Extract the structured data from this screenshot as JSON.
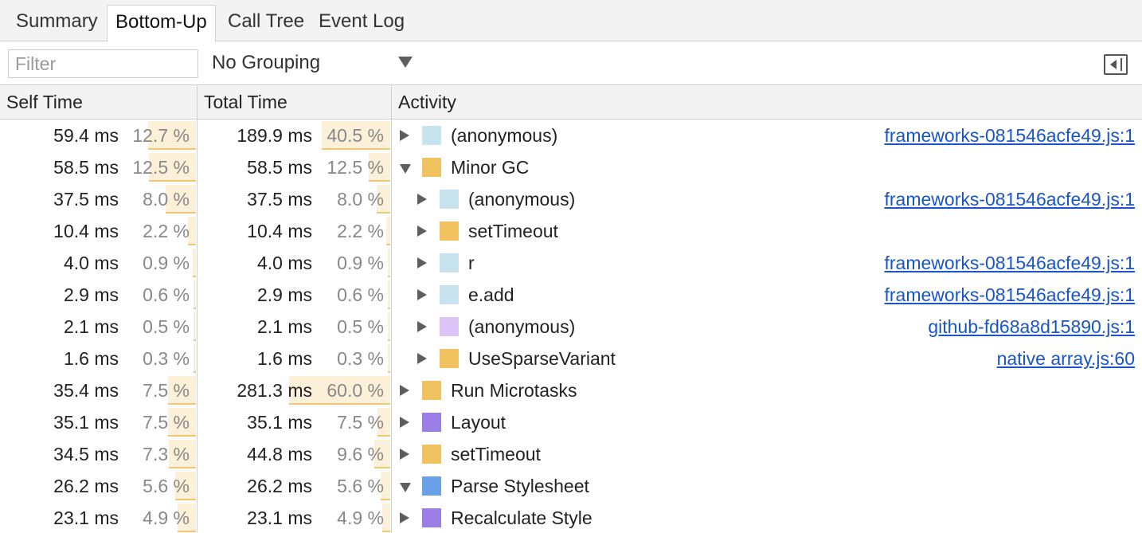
{
  "tabs": [
    {
      "label": "Summary",
      "active": false
    },
    {
      "label": "Bottom-Up",
      "active": true
    },
    {
      "label": "Call Tree",
      "active": false
    },
    {
      "label": "Event Log",
      "active": false
    }
  ],
  "toolbar": {
    "filter_placeholder": "Filter",
    "filter_value": "",
    "grouping_selected": "No Grouping"
  },
  "header": {
    "self_time": "Self Time",
    "total_time": "Total Time",
    "activity": "Activity"
  },
  "colors": {
    "scripting_light": "#c7e3ee",
    "scripting": "#f0c260",
    "rendering": "#9b7fe6",
    "rendering_light": "#dcc4f6",
    "loading": "#6aa0e6",
    "link": "#1a55c7"
  },
  "rows": [
    {
      "self_ms": "59.4 ms",
      "self_pct": "12.7 %",
      "self_frac": 0.127,
      "total_ms": "189.9 ms",
      "total_pct": "40.5 %",
      "total_frac": 0.405,
      "depth": 0,
      "expander": "collapsed",
      "color": "#c7e3ee",
      "name": "(anonymous)",
      "url": "frameworks-081546acfe49.js:1"
    },
    {
      "self_ms": "58.5 ms",
      "self_pct": "12.5 %",
      "self_frac": 0.125,
      "total_ms": "58.5 ms",
      "total_pct": "12.5 %",
      "total_frac": 0.125,
      "depth": 0,
      "expander": "expanded",
      "color": "#f0c260",
      "name": "Minor GC",
      "url": ""
    },
    {
      "self_ms": "37.5 ms",
      "self_pct": "8.0 %",
      "self_frac": 0.08,
      "total_ms": "37.5 ms",
      "total_pct": "8.0 %",
      "total_frac": 0.08,
      "depth": 1,
      "expander": "collapsed",
      "color": "#c7e3ee",
      "name": "(anonymous)",
      "url": "frameworks-081546acfe49.js:1"
    },
    {
      "self_ms": "10.4 ms",
      "self_pct": "2.2 %",
      "self_frac": 0.022,
      "total_ms": "10.4 ms",
      "total_pct": "2.2 %",
      "total_frac": 0.022,
      "depth": 1,
      "expander": "collapsed",
      "color": "#f0c260",
      "name": "setTimeout",
      "url": ""
    },
    {
      "self_ms": "4.0 ms",
      "self_pct": "0.9 %",
      "self_frac": 0.009,
      "total_ms": "4.0 ms",
      "total_pct": "0.9 %",
      "total_frac": 0.009,
      "depth": 1,
      "expander": "collapsed",
      "color": "#c7e3ee",
      "name": "r",
      "url": "frameworks-081546acfe49.js:1"
    },
    {
      "self_ms": "2.9 ms",
      "self_pct": "0.6 %",
      "self_frac": 0.006,
      "total_ms": "2.9 ms",
      "total_pct": "0.6 %",
      "total_frac": 0.006,
      "depth": 1,
      "expander": "collapsed",
      "color": "#c7e3ee",
      "name": "e.add",
      "url": "frameworks-081546acfe49.js:1"
    },
    {
      "self_ms": "2.1 ms",
      "self_pct": "0.5 %",
      "self_frac": 0.005,
      "total_ms": "2.1 ms",
      "total_pct": "0.5 %",
      "total_frac": 0.005,
      "depth": 1,
      "expander": "collapsed",
      "color": "#dcc4f6",
      "name": "(anonymous)",
      "url": "github-fd68a8d15890.js:1"
    },
    {
      "self_ms": "1.6 ms",
      "self_pct": "0.3 %",
      "self_frac": 0.003,
      "total_ms": "1.6 ms",
      "total_pct": "0.3 %",
      "total_frac": 0.003,
      "depth": 1,
      "expander": "collapsed",
      "color": "#f0c260",
      "name": "UseSparseVariant",
      "url": "native array.js:60"
    },
    {
      "self_ms": "35.4 ms",
      "self_pct": "7.5 %",
      "self_frac": 0.075,
      "total_ms": "281.3 ms",
      "total_pct": "60.0 %",
      "total_frac": 0.6,
      "depth": 0,
      "expander": "collapsed",
      "color": "#f0c260",
      "name": "Run Microtasks",
      "url": ""
    },
    {
      "self_ms": "35.1 ms",
      "self_pct": "7.5 %",
      "self_frac": 0.075,
      "total_ms": "35.1 ms",
      "total_pct": "7.5 %",
      "total_frac": 0.075,
      "depth": 0,
      "expander": "collapsed",
      "color": "#9b7fe6",
      "name": "Layout",
      "url": ""
    },
    {
      "self_ms": "34.5 ms",
      "self_pct": "7.3 %",
      "self_frac": 0.073,
      "total_ms": "44.8 ms",
      "total_pct": "9.6 %",
      "total_frac": 0.096,
      "depth": 0,
      "expander": "collapsed",
      "color": "#f0c260",
      "name": "setTimeout",
      "url": ""
    },
    {
      "self_ms": "26.2 ms",
      "self_pct": "5.6 %",
      "self_frac": 0.056,
      "total_ms": "26.2 ms",
      "total_pct": "5.6 %",
      "total_frac": 0.056,
      "depth": 0,
      "expander": "expanded",
      "color": "#6aa0e6",
      "name": "Parse Stylesheet",
      "url": ""
    },
    {
      "self_ms": "23.1 ms",
      "self_pct": "4.9 %",
      "self_frac": 0.049,
      "total_ms": "23.1 ms",
      "total_pct": "4.9 %",
      "total_frac": 0.049,
      "depth": 0,
      "expander": "collapsed",
      "color": "#9b7fe6",
      "name": "Recalculate Style",
      "url": ""
    }
  ]
}
